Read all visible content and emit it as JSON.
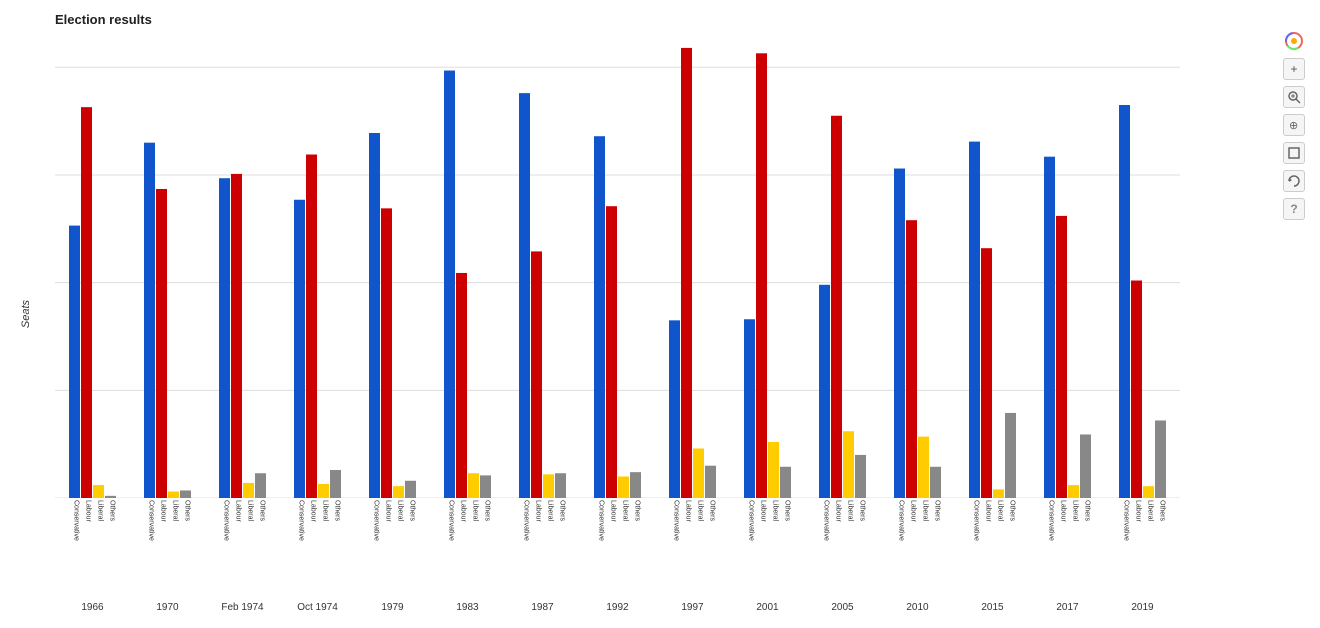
{
  "chart": {
    "title": "Election results",
    "y_axis_label": "Seats",
    "y_max": 430,
    "y_ticks": [
      0,
      100,
      200,
      300,
      400
    ],
    "elections": [
      {
        "year": "1966",
        "conservative": 253,
        "labour": 363,
        "liberal": 12,
        "others": 2
      },
      {
        "year": "1970",
        "conservative": 330,
        "labour": 287,
        "liberal": 6,
        "others": 7
      },
      {
        "year": "Feb 1974",
        "conservative": 297,
        "labour": 301,
        "liberal": 14,
        "others": 23
      },
      {
        "year": "Oct 1974",
        "conservative": 277,
        "labour": 319,
        "liberal": 13,
        "others": 26
      },
      {
        "year": "1979",
        "conservative": 339,
        "labour": 269,
        "liberal": 11,
        "others": 16
      },
      {
        "year": "1983",
        "conservative": 397,
        "labour": 209,
        "liberal": 23,
        "others": 21
      },
      {
        "year": "1987",
        "conservative": 376,
        "labour": 229,
        "liberal": 22,
        "others": 23
      },
      {
        "year": "1992",
        "conservative": 336,
        "labour": 271,
        "liberal": 20,
        "others": 24
      },
      {
        "year": "1997",
        "conservative": 165,
        "labour": 418,
        "liberal": 46,
        "others": 30
      },
      {
        "year": "2001",
        "conservative": 166,
        "labour": 413,
        "liberal": 52,
        "others": 29
      },
      {
        "year": "2005",
        "conservative": 198,
        "labour": 355,
        "liberal": 62,
        "others": 40
      },
      {
        "year": "2010",
        "conservative": 306,
        "labour": 258,
        "liberal": 57,
        "others": 29
      },
      {
        "year": "2015",
        "conservative": 331,
        "labour": 232,
        "liberal": 8,
        "others": 79
      },
      {
        "year": "2017",
        "conservative": 317,
        "labour": 262,
        "liberal": 12,
        "others": 59
      },
      {
        "year": "2019",
        "conservative": 365,
        "labour": 202,
        "liberal": 11,
        "others": 72
      }
    ],
    "bar_labels": [
      "Conservative",
      "Labour",
      "Liberal",
      "Others"
    ],
    "colors": {
      "conservative": "#1155cc",
      "labour": "#cc0000",
      "liberal": "#ffcc00",
      "others": "#888888"
    }
  },
  "toolbar": {
    "icons": [
      "logo",
      "zoom-in",
      "zoom-region",
      "pan",
      "frame",
      "reset",
      "help"
    ]
  }
}
